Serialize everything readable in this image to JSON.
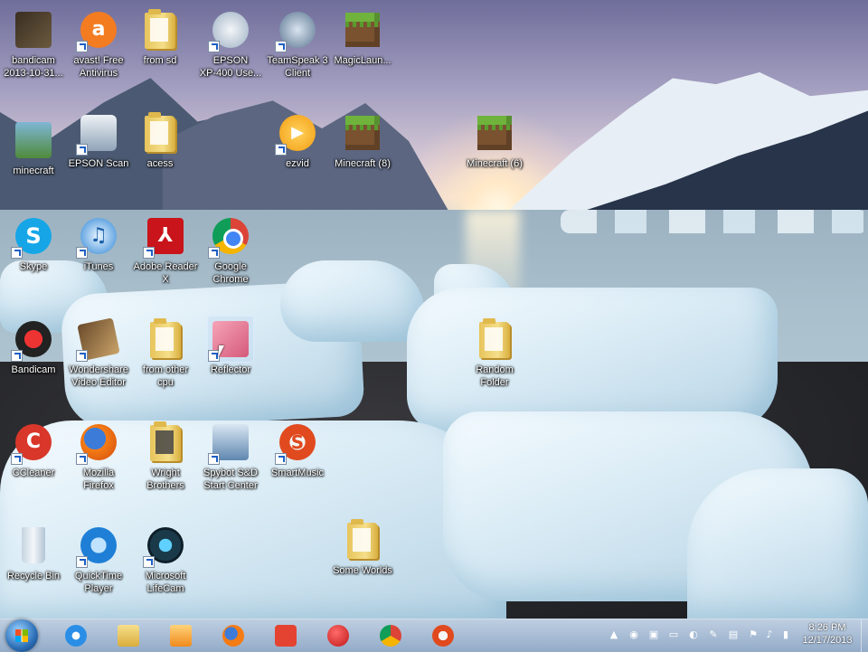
{
  "desktop": {
    "icons": [
      {
        "label": "bandicam\n2013-10-31..."
      },
      {
        "label": "avast! Free\nAntivirus"
      },
      {
        "label": "from sd"
      },
      {
        "label": "EPSON\nXP-400 Use..."
      },
      {
        "label": "TeamSpeak 3\nClient"
      },
      {
        "label": "MagicLaun..."
      },
      {
        "label": "minecraft"
      },
      {
        "label": "EPSON Scan"
      },
      {
        "label": "acess"
      },
      {
        "label": "ezvid"
      },
      {
        "label": "Minecraft (8)"
      },
      {
        "label": "Minecraft (6)"
      },
      {
        "label": "Skype"
      },
      {
        "label": "iTunes"
      },
      {
        "label": "Adobe Reader\nX"
      },
      {
        "label": "Google\nChrome"
      },
      {
        "label": "Bandicam"
      },
      {
        "label": "Wondershare\nVideo Editor"
      },
      {
        "label": "from other\ncpu"
      },
      {
        "label": "Reflector"
      },
      {
        "label": "Random\nFolder"
      },
      {
        "label": "CCleaner"
      },
      {
        "label": "Mozilla\nFirefox"
      },
      {
        "label": "Wright\nBrothers"
      },
      {
        "label": "Spybot S&D\nStart Center"
      },
      {
        "label": "SmartMusic"
      },
      {
        "label": "Recycle Bin"
      },
      {
        "label": "QuickTime\nPlayer"
      },
      {
        "label": "Microsoft\nLifeCam"
      },
      {
        "label": "Some Worlds"
      }
    ]
  },
  "taskbar": {
    "pinned": [
      "internet-explorer-icon",
      "file-explorer-icon",
      "media-player-icon",
      "firefox-icon",
      "todoist-icon",
      "pushpin-icon",
      "chrome-icon",
      "smartmusic-icon"
    ],
    "clock": {
      "time": "8:26 PM",
      "date": "12/17/2013"
    }
  },
  "colors": {
    "accent": "#2c6fb7",
    "label_text": "#ffffff"
  }
}
